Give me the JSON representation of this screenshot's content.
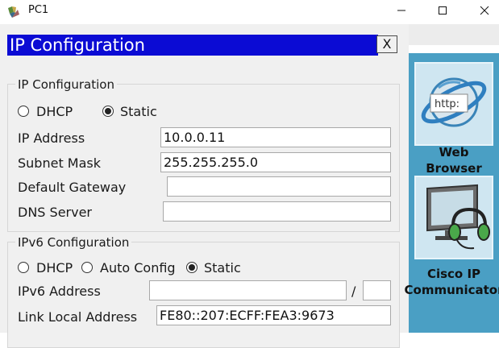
{
  "window": {
    "title": "PC1",
    "minimize_glyph": "—",
    "maximize_glyph": "☐",
    "close_glyph": "✕"
  },
  "dialog": {
    "title": "IP Configuration",
    "close_label": "X"
  },
  "ipv4": {
    "legend": "IP Configuration",
    "mode_dhcp_label": "DHCP",
    "mode_static_label": "Static",
    "selected_mode": "Static",
    "ip_address_label": "IP Address",
    "ip_address_value": "10.0.0.11",
    "subnet_mask_label": "Subnet Mask",
    "subnet_mask_value": "255.255.255.0",
    "default_gateway_label": "Default Gateway",
    "default_gateway_value": "",
    "dns_server_label": "DNS Server",
    "dns_server_value": ""
  },
  "ipv6": {
    "legend": "IPv6 Configuration",
    "mode_dhcp_label": "DHCP",
    "mode_auto_label": "Auto Config",
    "mode_static_label": "Static",
    "selected_mode": "Static",
    "address_label": "IPv6 Address",
    "address_value": "",
    "prefix_separator": "/",
    "prefix_value": "",
    "link_local_label": "Link Local Address",
    "link_local_value": "FE80::207:ECFF:FEA3:9673"
  },
  "apps": [
    {
      "label_line1": "Web",
      "label_line2": "Browser",
      "icon": "web-browser-icon",
      "icon_text": "http:"
    },
    {
      "label_line1": "Cisco IP",
      "label_line2": "Communicator",
      "icon": "cisco-ip-communicator-icon"
    }
  ],
  "colors": {
    "dialog_header": "#0b0bd4",
    "app_panel": "#4a9fc4"
  }
}
